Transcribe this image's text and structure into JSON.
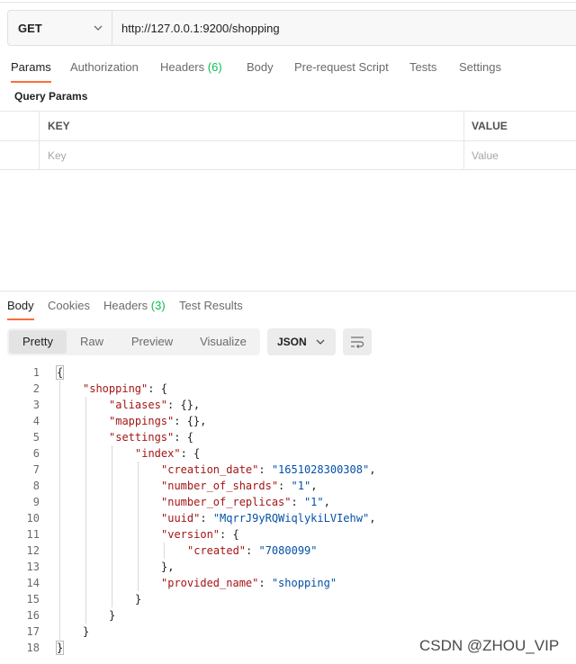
{
  "request": {
    "method": "GET",
    "url": "http://127.0.0.1:9200/shopping",
    "tabs": [
      {
        "label": "Params",
        "count": ""
      },
      {
        "label": "Authorization",
        "count": ""
      },
      {
        "label": "Headers",
        "count": "(6)"
      },
      {
        "label": "Body",
        "count": ""
      },
      {
        "label": "Pre-request Script",
        "count": ""
      },
      {
        "label": "Tests",
        "count": ""
      },
      {
        "label": "Settings",
        "count": ""
      }
    ],
    "active_tab": "Params",
    "query_params_title": "Query Params",
    "table": {
      "headers": {
        "key": "KEY",
        "value": "VALUE"
      },
      "placeholders": {
        "key": "Key",
        "value": "Value"
      }
    }
  },
  "response": {
    "tabs": [
      {
        "label": "Body",
        "count": ""
      },
      {
        "label": "Cookies",
        "count": ""
      },
      {
        "label": "Headers",
        "count": "(3)"
      },
      {
        "label": "Test Results",
        "count": ""
      }
    ],
    "active_tab": "Body",
    "view_modes": [
      "Pretty",
      "Raw",
      "Preview",
      "Visualize"
    ],
    "active_view": "Pretty",
    "format": "JSON",
    "body_lines": [
      {
        "n": "1",
        "indent": 0,
        "parts": [
          [
            "p",
            "{"
          ]
        ]
      },
      {
        "n": "2",
        "indent": 1,
        "parts": [
          [
            "k",
            "\"shopping\""
          ],
          [
            "p",
            ": {"
          ]
        ]
      },
      {
        "n": "3",
        "indent": 2,
        "parts": [
          [
            "k",
            "\"aliases\""
          ],
          [
            "p",
            ": {},"
          ]
        ]
      },
      {
        "n": "4",
        "indent": 2,
        "parts": [
          [
            "k",
            "\"mappings\""
          ],
          [
            "p",
            ": {},"
          ]
        ]
      },
      {
        "n": "5",
        "indent": 2,
        "parts": [
          [
            "k",
            "\"settings\""
          ],
          [
            "p",
            ": {"
          ]
        ]
      },
      {
        "n": "6",
        "indent": 3,
        "parts": [
          [
            "k",
            "\"index\""
          ],
          [
            "p",
            ": {"
          ]
        ]
      },
      {
        "n": "7",
        "indent": 4,
        "parts": [
          [
            "k",
            "\"creation_date\""
          ],
          [
            "p",
            ": "
          ],
          [
            "s",
            "\"1651028300308\""
          ],
          [
            "p",
            ","
          ]
        ]
      },
      {
        "n": "8",
        "indent": 4,
        "parts": [
          [
            "k",
            "\"number_of_shards\""
          ],
          [
            "p",
            ": "
          ],
          [
            "s",
            "\"1\""
          ],
          [
            "p",
            ","
          ]
        ]
      },
      {
        "n": "9",
        "indent": 4,
        "parts": [
          [
            "k",
            "\"number_of_replicas\""
          ],
          [
            "p",
            ": "
          ],
          [
            "s",
            "\"1\""
          ],
          [
            "p",
            ","
          ]
        ]
      },
      {
        "n": "10",
        "indent": 4,
        "parts": [
          [
            "k",
            "\"uuid\""
          ],
          [
            "p",
            ": "
          ],
          [
            "s",
            "\"MqrrJ9yRQWiqlykiLVIehw\""
          ],
          [
            "p",
            ","
          ]
        ]
      },
      {
        "n": "11",
        "indent": 4,
        "parts": [
          [
            "k",
            "\"version\""
          ],
          [
            "p",
            ": {"
          ]
        ]
      },
      {
        "n": "12",
        "indent": 5,
        "parts": [
          [
            "k",
            "\"created\""
          ],
          [
            "p",
            ": "
          ],
          [
            "s",
            "\"7080099\""
          ]
        ]
      },
      {
        "n": "13",
        "indent": 4,
        "parts": [
          [
            "p",
            "},"
          ]
        ]
      },
      {
        "n": "14",
        "indent": 4,
        "parts": [
          [
            "k",
            "\"provided_name\""
          ],
          [
            "p",
            ": "
          ],
          [
            "s",
            "\"shopping\""
          ]
        ]
      },
      {
        "n": "15",
        "indent": 3,
        "parts": [
          [
            "p",
            "}"
          ]
        ]
      },
      {
        "n": "16",
        "indent": 2,
        "parts": [
          [
            "p",
            "}"
          ]
        ]
      },
      {
        "n": "17",
        "indent": 1,
        "parts": [
          [
            "p",
            "}"
          ]
        ]
      },
      {
        "n": "18",
        "indent": 0,
        "parts": [
          [
            "p",
            "}"
          ]
        ]
      }
    ]
  },
  "watermark": "CSDN @ZHOU_VIP",
  "colors": {
    "accent": "#ff6c37",
    "count_green": "#0cbb52",
    "json_key": "#a31515",
    "json_string": "#0451a5"
  },
  "icons": {
    "method_dropdown": "chevron-down-icon",
    "format_dropdown": "chevron-down-icon",
    "wrap_toggle": "wrap-lines-icon"
  }
}
